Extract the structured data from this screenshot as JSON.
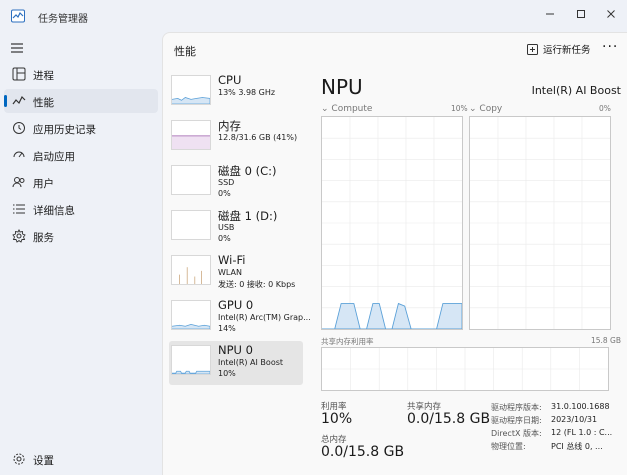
{
  "app": {
    "title": "任务管理器"
  },
  "colors": {
    "accent": "#0067c0",
    "graph_line": "#5aa0d8",
    "graph_fill": "#d6e6f5",
    "wifi_spike": "#c9a57a",
    "memory": "#9a5aa8"
  },
  "sidebar": {
    "items": [
      {
        "label": "进程",
        "icon": "processes-icon"
      },
      {
        "label": "性能",
        "icon": "performance-icon",
        "active": true
      },
      {
        "label": "应用历史记录",
        "icon": "history-icon"
      },
      {
        "label": "启动应用",
        "icon": "startup-icon"
      },
      {
        "label": "用户",
        "icon": "users-icon"
      },
      {
        "label": "详细信息",
        "icon": "details-icon"
      },
      {
        "label": "服务",
        "icon": "services-icon"
      }
    ],
    "settings_label": "设置"
  },
  "header": {
    "title": "性能",
    "run_task_label": "运行新任务",
    "more": "···"
  },
  "devices": [
    {
      "name": "CPU",
      "sub": "13%  3.98 GHz",
      "sub2": ""
    },
    {
      "name": "内存",
      "sub": "12.8/31.6 GB (41%)",
      "sub2": ""
    },
    {
      "name": "磁盘 0 (C:)",
      "sub": "SSD",
      "sub2": "0%"
    },
    {
      "name": "磁盘 1 (D:)",
      "sub": "USB",
      "sub2": "0%"
    },
    {
      "name": "Wi-Fi",
      "sub": "WLAN",
      "sub2": "发送: 0 接收: 0 Kbps"
    },
    {
      "name": "GPU 0",
      "sub": "Intel(R) Arc(TM) Grap...",
      "sub2": "14%"
    },
    {
      "name": "NPU 0",
      "sub": "Intel(R) AI Boost",
      "sub2": "10%",
      "active": true
    }
  ],
  "detail": {
    "title": "NPU",
    "model": "Intel(R) AI Boost",
    "graph_left": {
      "label": "Compute",
      "pct": "10%"
    },
    "graph_right": {
      "label": "Copy",
      "pct": "0%"
    },
    "shared_memory_label": "共享内存利用率",
    "shared_memory_max": "15.8 GB",
    "stats": {
      "utilization_label": "利用率",
      "utilization_value": "10%",
      "shared_label": "共享内存",
      "shared_value": "0.0/15.8 GB",
      "memory_label": "总内存",
      "memory_value": "0.0/15.8 GB"
    },
    "props": [
      {
        "label": "驱动程序版本:",
        "value": "31.0.100.1688"
      },
      {
        "label": "驱动程序日期:",
        "value": "2023/10/31"
      },
      {
        "label": "DirectX 版本:",
        "value": "12 (FL 1.0 : C..."
      },
      {
        "label": "物理位置:",
        "value": "PCI 总线 0, ..."
      }
    ]
  },
  "compute_usage_percent": [
    0,
    0,
    0,
    10,
    10,
    10,
    0,
    0,
    10,
    10,
    0,
    0,
    10,
    9,
    0,
    0,
    0,
    0,
    0,
    10,
    10,
    10,
    10
  ]
}
